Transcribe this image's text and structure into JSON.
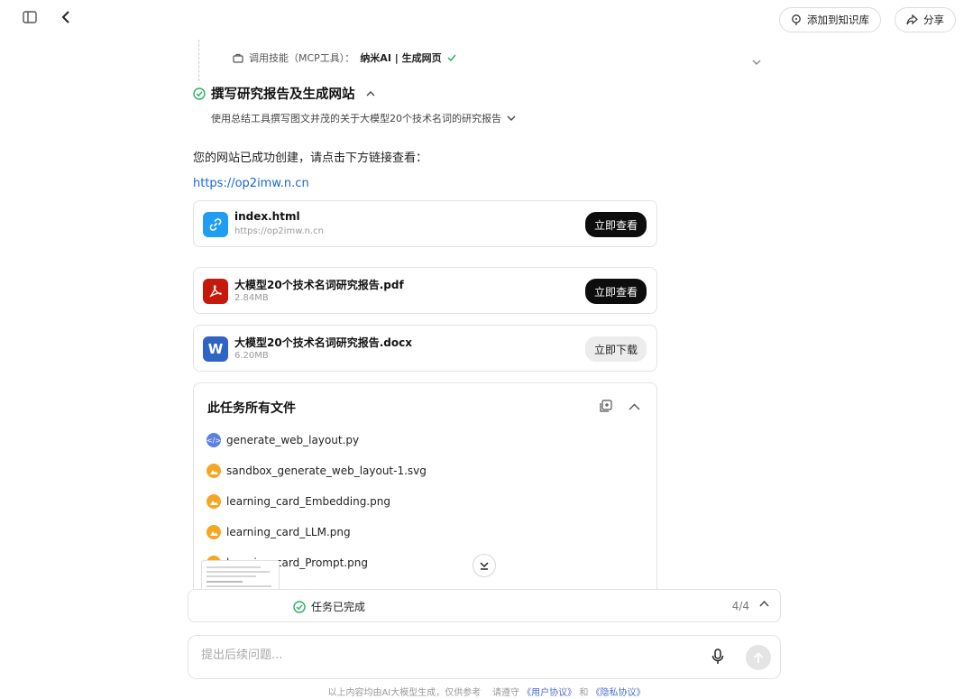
{
  "header": {
    "add_knowledge_label": "添加到知识库",
    "share_label": "分享"
  },
  "step": {
    "mcp_prefix": "调用技能（MCP工具）：",
    "mcp_tool": "纳米AI | 生成网页",
    "title": "撰写研究报告及生成网站",
    "subtitle": "使用总结工具撰写图文并茂的关于大模型20个技术名词的研究报告"
  },
  "message": {
    "text": "您的网站已成功创建，请点击下方链接查看：",
    "link": "https://op2imw.n.cn"
  },
  "files": [
    {
      "name": "index.html",
      "meta": "https://op2imw.n.cn",
      "button": "立即查看",
      "icon": "link-icon",
      "icon_color": "#1e9df2"
    },
    {
      "name": "大模型20个技术名词研究报告.pdf",
      "meta": "2.84MB",
      "button": "立即查看",
      "icon": "pdf-icon",
      "icon_color": "#c6190c"
    },
    {
      "name": "大模型20个技术名词研究报告.docx",
      "meta": "6.20MB",
      "button": "立即下载",
      "icon": "word-icon",
      "icon_color": "#2f63c4"
    }
  ],
  "all_files": {
    "title": "此任务所有文件",
    "items": [
      {
        "name": "generate_web_layout.py",
        "icon": "code-file-icon",
        "color": "#5b7fe3"
      },
      {
        "name": "sandbox_generate_web_layout-1.svg",
        "icon": "image-file-icon",
        "color": "#f5a623"
      },
      {
        "name": "learning_card_Embedding.png",
        "icon": "image-file-icon",
        "color": "#f5a623"
      },
      {
        "name": "learning_card_LLM.png",
        "icon": "image-file-icon",
        "color": "#f5a623"
      },
      {
        "name": "learning_card_Prompt.png",
        "icon": "image-file-icon",
        "color": "#f5a623"
      }
    ]
  },
  "status": {
    "text": "任务已完成",
    "count": "4/4"
  },
  "input": {
    "placeholder": "提出后续问题..."
  },
  "footer": {
    "prefix": "以上内容均由AI大模型生成，仅供参考",
    "middle": "请遵守",
    "user_agreement": "《用户协议》",
    "and": "和",
    "privacy": "《隐私协议》"
  },
  "colors": {
    "accent": "#1a66d9",
    "success": "#22b35e",
    "dark_button": "#0d0d0d"
  }
}
